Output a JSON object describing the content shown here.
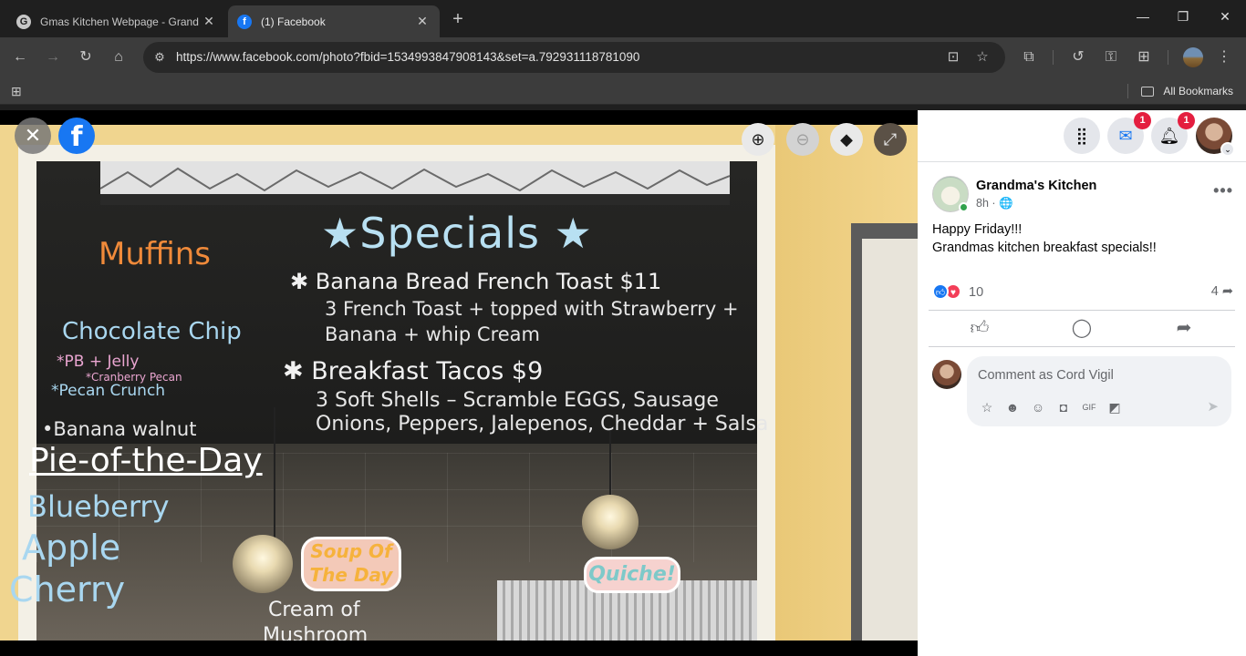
{
  "browser": {
    "tabs": [
      {
        "title": "Gmas Kitchen Webpage - Grand",
        "fav": "G"
      },
      {
        "title": "(1) Facebook",
        "fav": "f"
      }
    ],
    "url": "https://www.facebook.com/photo?fbid=1534993847908143&set=a.792931118781090",
    "all_bookmarks": "All Bookmarks",
    "icons": [
      "back-icon",
      "forward-icon",
      "reload-icon",
      "home-icon",
      "site-info-icon",
      "install-app-icon",
      "star-icon",
      "extensions-icon",
      "history-icon",
      "password-icon",
      "reading-list-icon",
      "menu-icon",
      "apps-grid-icon",
      "folder-icon",
      "new-tab-icon",
      "minimize-icon",
      "maximize-icon",
      "close-window-icon"
    ]
  },
  "viewer": {
    "icons": [
      "close-icon",
      "facebook-logo-icon",
      "zoom-in-icon",
      "zoom-out-icon",
      "tag-icon",
      "fullscreen-icon"
    ]
  },
  "photo": {
    "title": "★Specials ★",
    "muffins": "Muffins",
    "muffin_items": [
      "Chocolate Chip",
      "*PB + Jelly",
      "*Cranberry Pecan",
      "*Pecan Crunch",
      "•Banana walnut"
    ],
    "pie_heading": "Pie-of-the-Day",
    "pie_items": [
      "Blueberry",
      "Apple",
      "Cherry"
    ],
    "special1": "✱ Banana Bread French Toast $11",
    "special1_desc1": "3 French Toast + topped with Strawberry +",
    "special1_desc2": "Banana + whip Cream",
    "special2": "✱ Breakfast Tacos $9",
    "special2_desc1": "3 Soft Shells – Scramble EGGS, Sausage",
    "special2_desc2": "Onions, Peppers, Jalepenos, Cheddar + Salsa",
    "soup_sticker": "Soup Of The Day",
    "soup_text1": "Cream of",
    "soup_text2": "Mushroom",
    "quiche_sticker": "Quiche!"
  },
  "sidebar": {
    "nav": {
      "messenger_badge": "1",
      "notif_badge": "1"
    },
    "post": {
      "page_name": "Grandma's Kitchen",
      "time": "8h · 🌐",
      "line1": "Happy Friday!!!",
      "line2": "Grandmas kitchen breakfast specials!!",
      "reactions": "10",
      "shares": "4"
    },
    "comment_placeholder": "Comment as Cord Vigil",
    "comment_icons": [
      "avatar-sticker-icon",
      "emoji-face-icon",
      "smiley-icon",
      "camera-icon",
      "gif-icon",
      "sticker-icon",
      "send-icon"
    ]
  },
  "colors": {
    "facebook_blue": "#1877f2",
    "badge_red": "#e41e3f",
    "love_red": "#f33e58",
    "chrome_dark": "#1f1f1f",
    "chrome_toolbar": "#3c3c3c"
  }
}
